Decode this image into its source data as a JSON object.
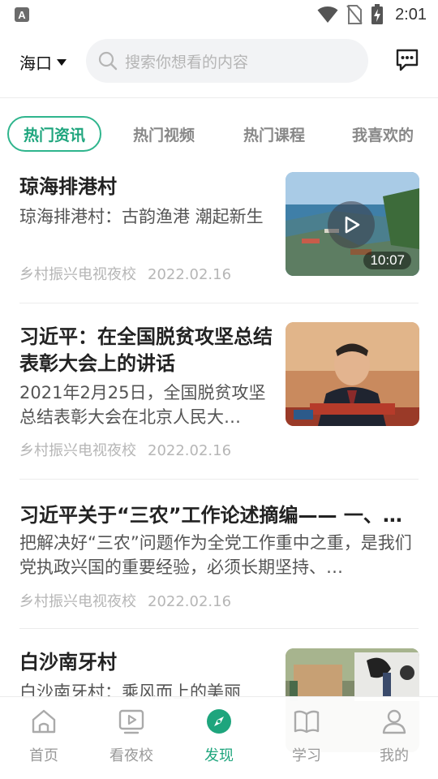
{
  "status_bar": {
    "app_badge": "A",
    "time": "2:01",
    "icons": [
      "wifi-icon",
      "no-sim-icon",
      "battery-charging-icon"
    ]
  },
  "header": {
    "city": "海口",
    "search_placeholder": "搜索你想看的内容",
    "message_icon": "chat-bubble-icon"
  },
  "tabs": [
    {
      "label": "热门资讯",
      "active": true
    },
    {
      "label": "热门视频",
      "active": false
    },
    {
      "label": "热门课程",
      "active": false
    },
    {
      "label": "我喜欢的",
      "active": false
    }
  ],
  "feed": [
    {
      "title": "琼海排港村",
      "summary": "琼海排港村：古韵渔港 潮起新生",
      "source": "乡村振兴电视夜校",
      "date": "2022.02.16",
      "duration": "10:07"
    },
    {
      "title": "习近平：在全国脱贫攻坚总结表彰大会上的讲话",
      "summary": "2021年2月25日，全国脱贫攻坚总结表彰大会在北京人民大…",
      "source": "乡村振兴电视夜校",
      "date": "2022.02.16"
    },
    {
      "title": "习近平关于“三农”工作论述摘编—— 一、…",
      "summary": "把解决好“三农”问题作为全党工作重中之重，是我们党执政兴国的重要经验，必须长期坚持、…",
      "source": "乡村振兴电视夜校",
      "date": "2022.02.16"
    },
    {
      "title": "白沙南牙村",
      "summary": "白沙南牙村：乘风而上的美丽"
    }
  ],
  "bottom_nav": [
    {
      "label": "首页",
      "icon": "home-icon",
      "active": false
    },
    {
      "label": "看夜校",
      "icon": "video-play-icon",
      "active": false
    },
    {
      "label": "发现",
      "icon": "compass-icon",
      "active": true
    },
    {
      "label": "学习",
      "icon": "book-icon",
      "active": false
    },
    {
      "label": "我的",
      "icon": "user-icon",
      "active": false
    }
  ],
  "colors": {
    "accent": "#1ea57d",
    "tab_border": "#2fb58d",
    "search_bg": "#f2f3f5",
    "meta_text": "#b6b6b6"
  }
}
